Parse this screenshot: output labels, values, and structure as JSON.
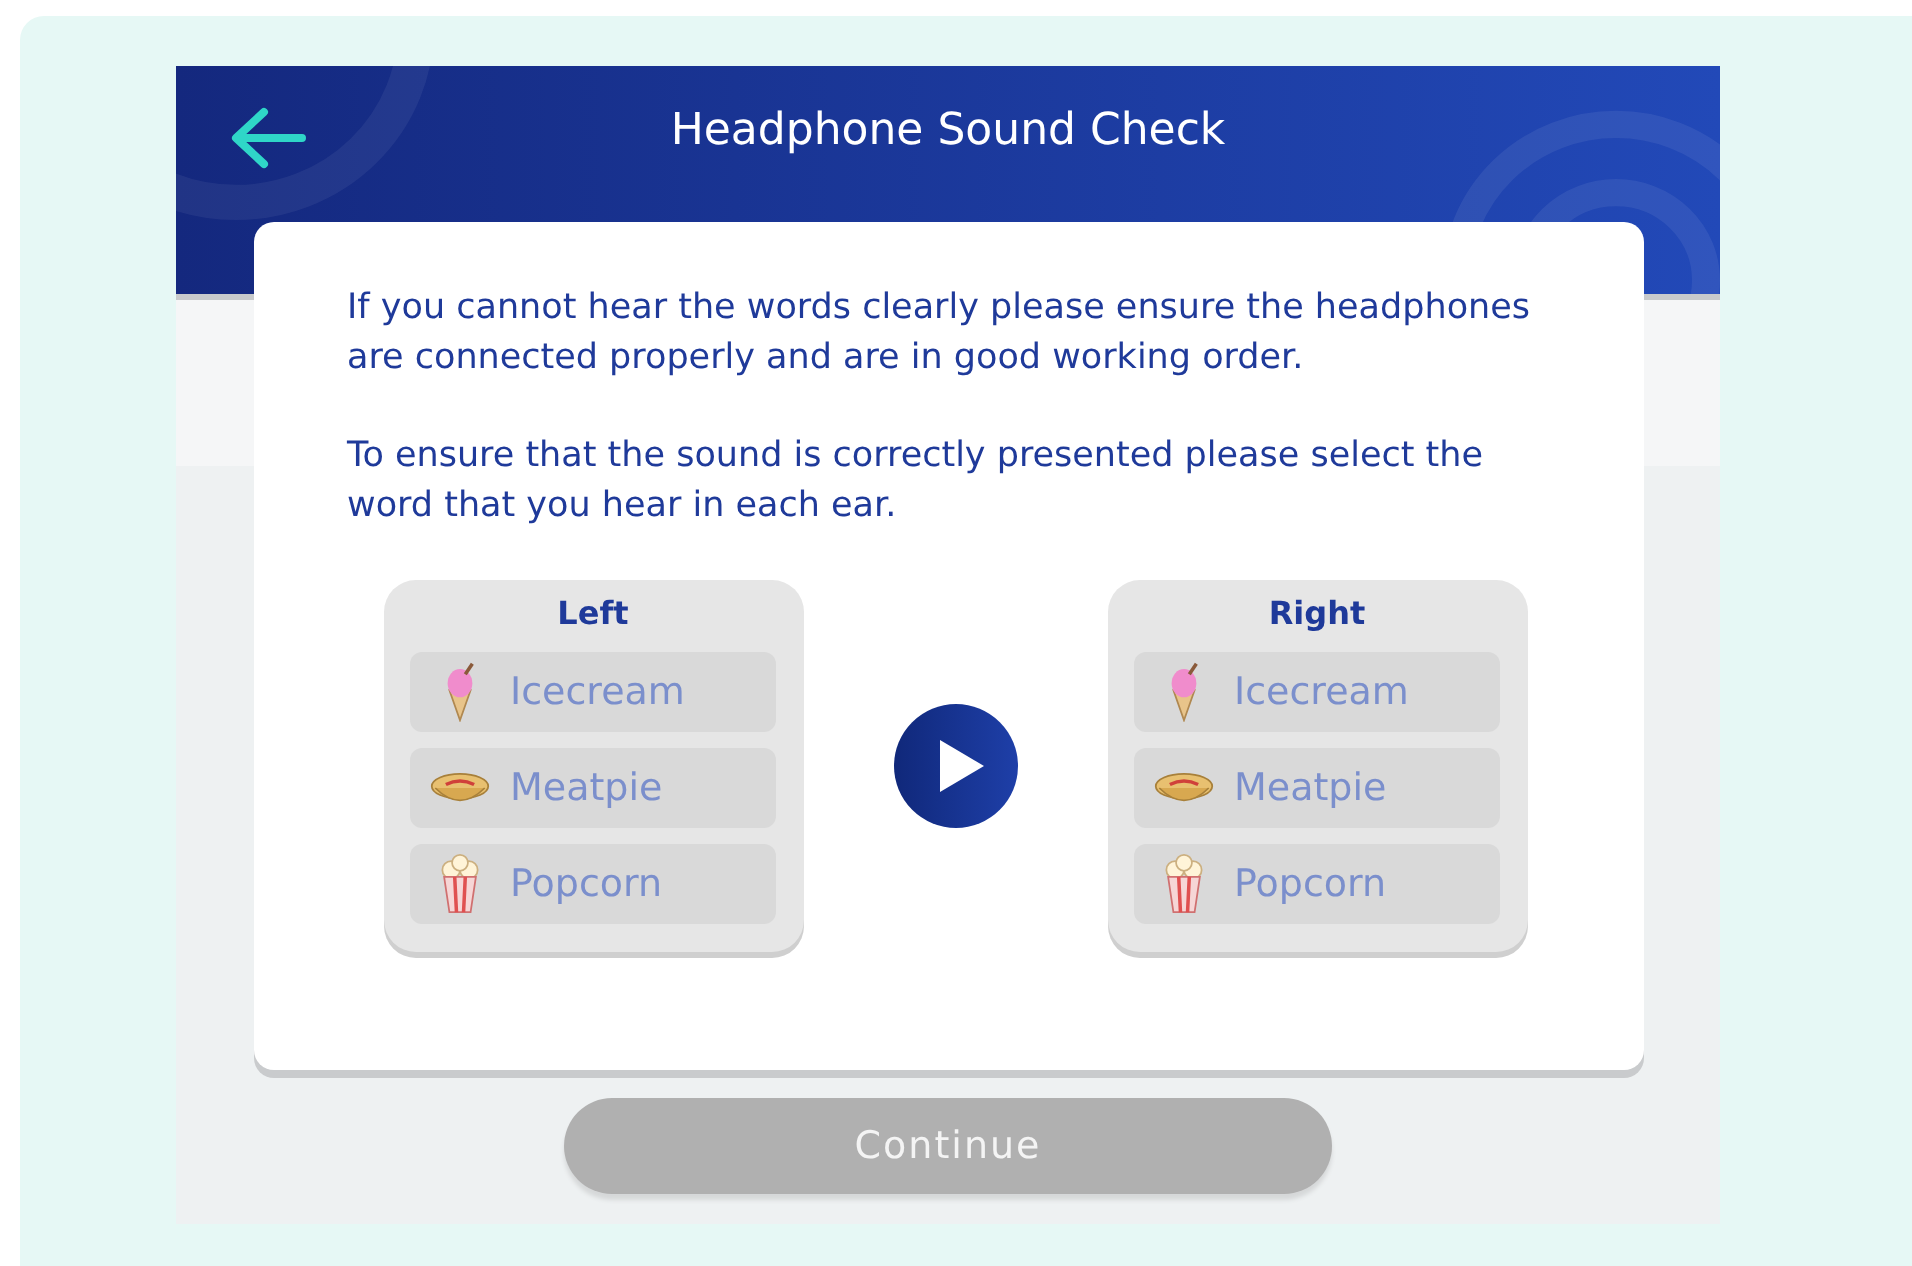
{
  "header": {
    "title": "Headphone Sound Check"
  },
  "instructions": [
    "If you cannot hear the words clearly please ensure the headphones are connected properly and are in good working order.",
    "To ensure that the sound is correctly presented please select the word that you hear in each ear."
  ],
  "ears": [
    {
      "label": "Left",
      "options": [
        {
          "kind": "icecream",
          "label": "Icecream",
          "selected": false
        },
        {
          "kind": "meatpie",
          "label": "Meatpie",
          "selected": false
        },
        {
          "kind": "popcorn",
          "label": "Popcorn",
          "selected": false
        }
      ]
    },
    {
      "label": "Right",
      "options": [
        {
          "kind": "icecream",
          "label": "Icecream",
          "selected": false
        },
        {
          "kind": "meatpie",
          "label": "Meatpie",
          "selected": false
        },
        {
          "kind": "popcorn",
          "label": "Popcorn",
          "selected": false
        }
      ]
    }
  ],
  "continue_button": {
    "label": "Continue",
    "disabled": true
  }
}
